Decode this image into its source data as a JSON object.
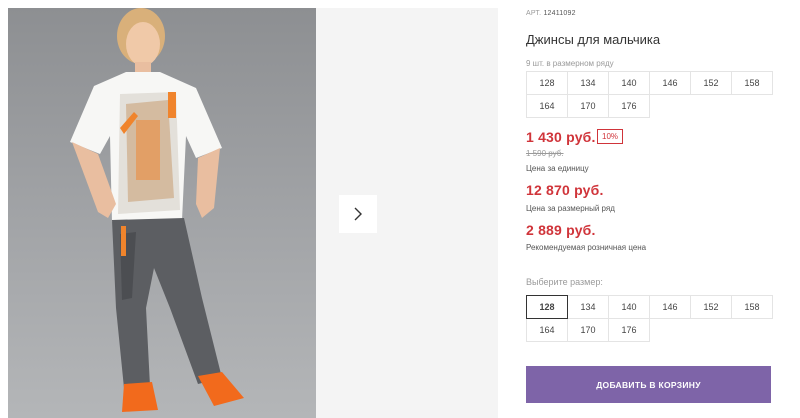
{
  "product": {
    "article_label": "АРТ.",
    "article": "12411092",
    "title": "Джинсы для мальчика",
    "pack_label": "9 шт. в размерном ряду"
  },
  "size_row": [
    "128",
    "134",
    "140",
    "146",
    "152",
    "158",
    "164",
    "170",
    "176"
  ],
  "prices": {
    "unit_price": "1 430 руб.",
    "discount": "10%",
    "old_price": "1 590 руб.",
    "unit_label": "Цена за единицу",
    "row_price": "12 870 руб.",
    "row_label": "Цена за размерный ряд",
    "retail_price": "2 889 руб.",
    "retail_label": "Рекомендуемая розничная цена"
  },
  "size_picker": {
    "label": "Выберите размер:",
    "selected": "128",
    "options": [
      "128",
      "134",
      "140",
      "146",
      "152",
      "158",
      "164",
      "170",
      "176"
    ]
  },
  "actions": {
    "add_to_cart": "ДОБАВИТЬ В КОРЗИНУ"
  },
  "icons": {
    "next": "chevron-right-icon"
  },
  "colors": {
    "price_red": "#d0343a",
    "button_purple": "#7e64a8"
  }
}
